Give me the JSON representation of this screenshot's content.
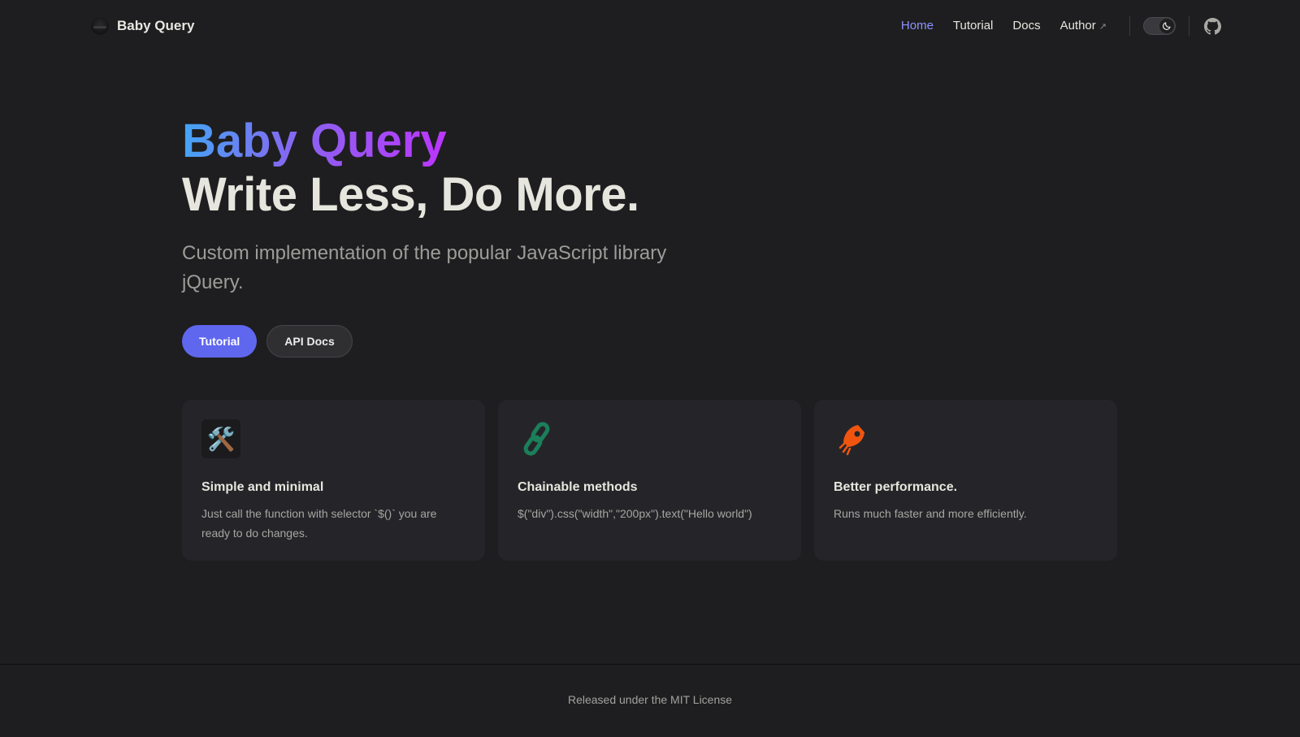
{
  "brand": {
    "name": "Baby Query"
  },
  "nav": {
    "items": [
      {
        "label": "Home",
        "active": true
      },
      {
        "label": "Tutorial"
      },
      {
        "label": "Docs"
      },
      {
        "label": "Author",
        "external_arrow": "↗"
      }
    ],
    "theme": "dark"
  },
  "hero": {
    "name": "Baby Query",
    "text": "Write Less, Do More.",
    "tagline": "Custom implementation of the popular JavaScript library jQuery.",
    "actions": [
      {
        "label": "Tutorial",
        "style": "brand"
      },
      {
        "label": "API Docs",
        "style": "alt"
      }
    ]
  },
  "features": [
    {
      "icon": "🛠️",
      "icon_name": "tools-icon",
      "title": "Simple and minimal",
      "details": "Just call the function with selector `$()` you are ready to do changes."
    },
    {
      "icon_name": "chain-link-icon",
      "title": "Chainable methods",
      "details": "$(\"div\").css(\"width\",\"200px\").text(\"Hello world\")"
    },
    {
      "icon_name": "rocket-icon",
      "title": "Better performance.",
      "details": "Runs much faster and more efficiently."
    }
  ],
  "footer": {
    "message": "Released under the MIT License"
  },
  "colors": {
    "background": "#1e1e20",
    "brand": "#5f67ee",
    "nav_active": "#8f93ff",
    "gradient_start": "#41a7f5",
    "gradient_end": "#bd34fe",
    "link_icon": "#1a7f5a",
    "rocket_icon": "#f0550f"
  }
}
